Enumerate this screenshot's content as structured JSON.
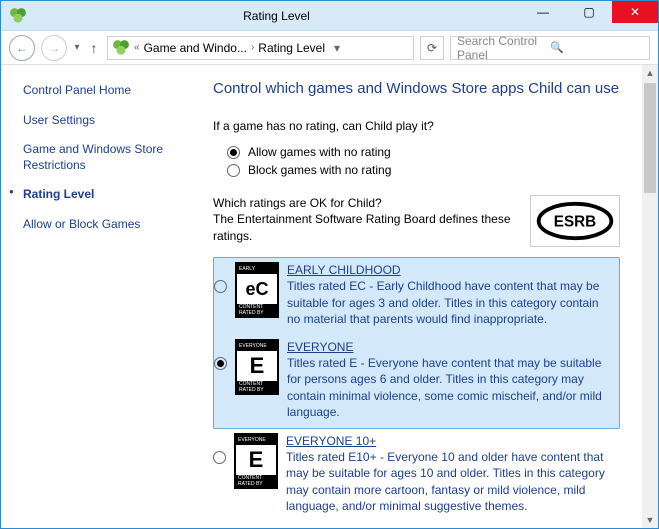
{
  "window": {
    "title": "Rating Level"
  },
  "title_buttons": {
    "min": "—",
    "max": "▢",
    "close": "✕"
  },
  "nav": {
    "back": "←",
    "forward": "→",
    "history": "▾",
    "up": "↑",
    "bc_laquo": "«",
    "bc_chev": "›",
    "bc_dd": "▾",
    "refresh": "⟳",
    "search_icon": "🔍"
  },
  "breadcrumb": {
    "item1": "Game and Windo...",
    "item2": "Rating Level"
  },
  "search": {
    "placeholder": "Search Control Panel"
  },
  "sidebar": {
    "items": [
      {
        "label": "Control Panel Home"
      },
      {
        "label": "User Settings"
      },
      {
        "label": "Game and Windows Store Restrictions"
      },
      {
        "label": "Rating Level"
      },
      {
        "label": "Allow or Block Games"
      }
    ]
  },
  "main": {
    "heading": "Control which games and Windows Store apps Child can use",
    "question1": "If a game has no rating, can Child play it?",
    "allow_no_rating": "Allow games with no rating",
    "block_no_rating": "Block games with no rating",
    "question2a": "Which ratings are OK for Child?",
    "question2b": "The Entertainment Software Rating Board defines these ratings.",
    "esrb": "ESRB"
  },
  "ratings": [
    {
      "badge_top": "EARLY CHILDHOOD",
      "badge_mid": "eC",
      "badge_bot": "CONTENT RATED BY ESRB",
      "title": "EARLY CHILDHOOD",
      "desc": "Titles rated EC - Early Childhood have content that may be suitable for ages 3 and older.  Titles in this category contain no material that parents would find inappropriate.",
      "selected": true,
      "checked": false
    },
    {
      "badge_top": "EVERYONE",
      "badge_mid": "E",
      "badge_bot": "CONTENT RATED BY ESRB",
      "title": "EVERYONE",
      "desc": "Titles rated E - Everyone have content that may be suitable for persons ages 6 and older.  Titles in this category may contain minimal violence, some comic mischeif, and/or mild language.",
      "selected": true,
      "checked": true
    },
    {
      "badge_top": "EVERYONE 10+",
      "badge_mid": "E",
      "badge_bot": "CONTENT RATED BY ESRB",
      "title": "EVERYONE 10+",
      "desc": "Titles rated E10+ - Everyone 10 and older have content that may be suitable for ages 10 and older. Titles in this category may contain more cartoon, fantasy or mild violence, mild language, and/or minimal suggestive themes.",
      "selected": false,
      "checked": false
    }
  ]
}
